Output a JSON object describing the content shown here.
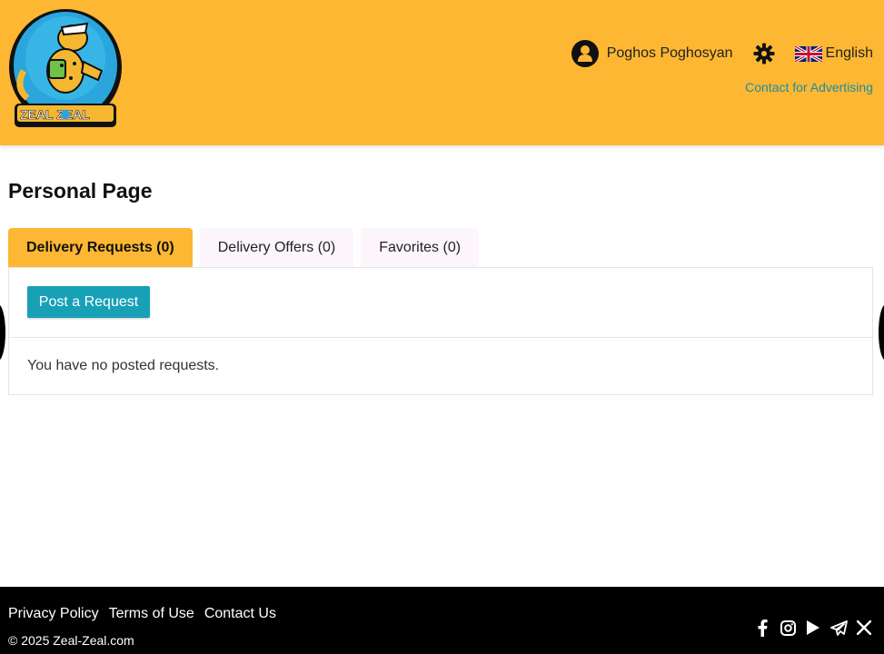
{
  "header": {
    "logo_text": "ZEAL ZEAL",
    "user_name": "Poghos Poghosyan",
    "language": "English",
    "contact_ad_link": "Contact for Advertising"
  },
  "main": {
    "title": "Personal Page",
    "tabs": [
      {
        "label": "Delivery Requests (0)",
        "active": true
      },
      {
        "label": "Delivery Offers (0)",
        "active": false
      },
      {
        "label": "Favorites (0)",
        "active": false
      }
    ],
    "post_button": "Post a Request",
    "empty_message": "You have no posted requests."
  },
  "footer": {
    "links": [
      "Privacy Policy",
      "Terms of Use",
      "Contact Us"
    ],
    "copyright": "© 2025 Zeal-Zeal.com",
    "social_icons": [
      "facebook-icon",
      "instagram-icon",
      "youtube-icon",
      "telegram-icon",
      "x-icon"
    ]
  },
  "colors": {
    "brand_yellow": "#fdb733",
    "accent_teal": "#18a0b6",
    "link_teal": "#1a8ea3",
    "footer_black": "#000000"
  }
}
